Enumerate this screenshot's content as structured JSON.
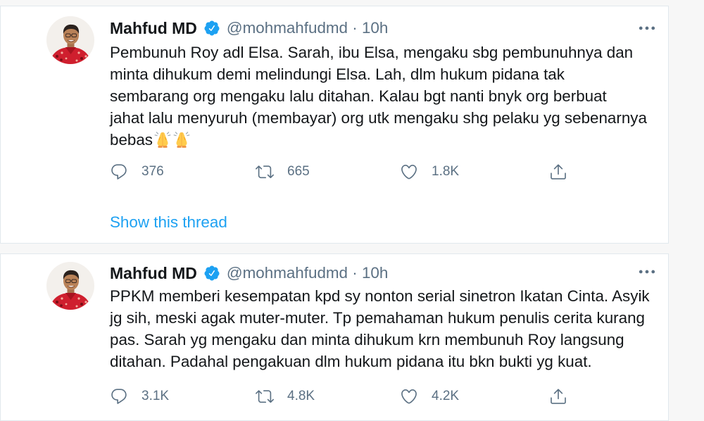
{
  "colors": {
    "text_primary": "#14171a",
    "text_secondary": "#5b7083",
    "link_blue": "#1da1f2",
    "verified_blue": "#1da1f2",
    "card_background": "#ffffff",
    "card_border": "#e1e8ed"
  },
  "tweets": [
    {
      "author": {
        "name": "Mahfud MD",
        "verified": true,
        "verified_icon": "verified-badge-icon",
        "handle": "@mohmahfudmd",
        "separator": "·",
        "time": "10h"
      },
      "more_icon": "more-icon",
      "text_lines": [
        "Pembunuh Roy adl Elsa. Sarah, ibu Elsa, mengaku sbg pembunuhnya dan",
        "minta dihukum demi melindungi Elsa. Lah, dlm hukum pidana tak",
        "sembarang org mengaku lalu ditahan. Kalau bgt nanti bnyk org berbuat",
        "jahat lalu menyuruh (membayar) org utk mengaku shg pelaku yg sebenarnya",
        "bebas"
      ],
      "trailing_emoji": [
        "folded-hands-icon",
        "folded-hands-icon"
      ],
      "actions": [
        {
          "icon": "reply-icon",
          "count": "376"
        },
        {
          "icon": "retweet-icon",
          "count": "665"
        },
        {
          "icon": "like-icon",
          "count": "1.8K"
        },
        {
          "icon": "share-icon"
        }
      ],
      "show_thread": "Show this thread"
    },
    {
      "author": {
        "name": "Mahfud MD",
        "verified": true,
        "verified_icon": "verified-badge-icon",
        "handle": "@mohmahfudmd",
        "separator": "·",
        "time": "10h"
      },
      "more_icon": "more-icon",
      "text_lines": [
        "PPKM memberi kesempatan kpd sy nonton serial sinetron Ikatan Cinta. Asyik",
        "jg sih, meski agak muter-muter. Tp pemahaman hukum penulis cerita kurang",
        "pas. Sarah yg mengaku dan minta dihukum krn membunuh Roy langsung",
        "ditahan. Padahal pengakuan dlm hukum pidana itu bkn bukti yg kuat."
      ],
      "actions": [
        {
          "icon": "reply-icon",
          "count": "3.1K"
        },
        {
          "icon": "retweet-icon",
          "count": "4.8K"
        },
        {
          "icon": "like-icon",
          "count": "4.2K"
        },
        {
          "icon": "share-icon"
        }
      ]
    }
  ]
}
